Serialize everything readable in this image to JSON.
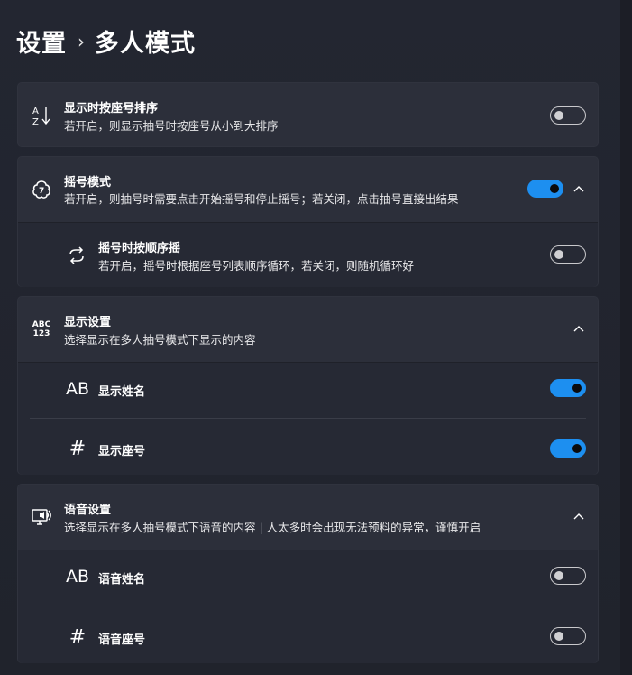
{
  "breadcrumb": {
    "parent": "设置",
    "separator": "›",
    "current": "多人模式"
  },
  "sort_card": {
    "title": "显示时按座号排序",
    "desc": "若开启，则显示抽号时按座号从小到大排序",
    "icon": "sort-az-icon",
    "enabled": false
  },
  "shake_card": {
    "title": "摇号模式",
    "desc": "若开启，则抽号时需要点击开始摇号和停止摇号；若关闭，点击抽号直接出结果",
    "icon": "dice-icon",
    "enabled": true,
    "expanded": true,
    "sub": {
      "title": "摇号时按顺序摇",
      "desc": "若开启，摇号时根据座号列表顺序循环，若关闭，则随机循环好",
      "icon": "cycle-icon",
      "enabled": false
    }
  },
  "display_card": {
    "title": "显示设置",
    "desc": "选择显示在多人抽号模式下显示的内容",
    "icon_text": "ABC\n123",
    "expanded": true,
    "items": [
      {
        "label": "显示姓名",
        "icon": "ab-icon",
        "icon_text": "AB",
        "enabled": true
      },
      {
        "label": "显示座号",
        "icon": "hash-icon",
        "icon_text": "#",
        "enabled": true
      }
    ]
  },
  "voice_card": {
    "title": "语音设置",
    "desc": "选择显示在多人抽号模式下语音的内容 | 人太多时会出现无法预料的异常，谨慎开启",
    "icon": "speaker-monitor-icon",
    "expanded": true,
    "items": [
      {
        "label": "语音姓名",
        "icon": "ab-icon",
        "icon_text": "AB",
        "enabled": false
      },
      {
        "label": "语音座号",
        "icon": "hash-icon",
        "icon_text": "#",
        "enabled": false
      }
    ]
  },
  "colors": {
    "accent": "#1d8ff0",
    "card": "#2c2f3a",
    "background": "#22252e"
  }
}
